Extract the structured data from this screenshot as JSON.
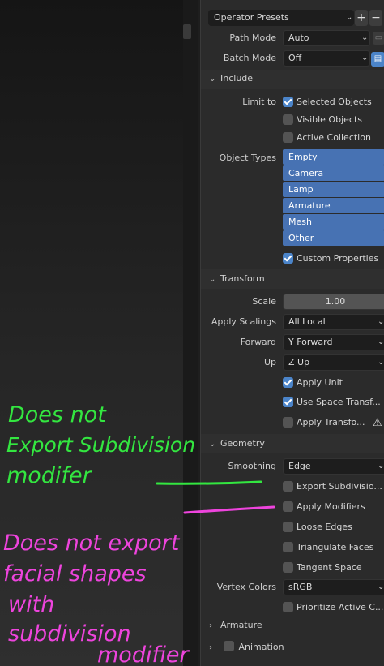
{
  "colors": {
    "accent": "#4772b3",
    "annotation_green": "#33e640",
    "annotation_pink": "#ee44dd"
  },
  "header": {
    "presets_label": "Operator Presets",
    "add_icon": "+",
    "remove_icon": "−"
  },
  "fields": {
    "path_mode": {
      "label": "Path Mode",
      "value": "Auto"
    },
    "batch_mode": {
      "label": "Batch Mode",
      "value": "Off"
    }
  },
  "include": {
    "title": "Include",
    "limit_to_label": "Limit to",
    "selected_objects": "Selected Objects",
    "visible_objects": "Visible Objects",
    "active_collection": "Active Collection",
    "object_types_label": "Object Types",
    "object_types": [
      "Empty",
      "Camera",
      "Lamp",
      "Armature",
      "Mesh",
      "Other"
    ],
    "custom_properties": "Custom Properties"
  },
  "transform": {
    "title": "Transform",
    "scale_label": "Scale",
    "scale_value": "1.00",
    "apply_scalings_label": "Apply Scalings",
    "apply_scalings_value": "All Local",
    "forward_label": "Forward",
    "forward_value": "Y Forward",
    "up_label": "Up",
    "up_value": "Z Up",
    "apply_unit": "Apply Unit",
    "use_space_transform": "Use Space Transf...",
    "apply_transform": "Apply Transfo..."
  },
  "geometry": {
    "title": "Geometry",
    "smoothing_label": "Smoothing",
    "smoothing_value": "Edge",
    "export_subdivision": "Export Subdivisio...",
    "apply_modifiers": "Apply Modifiers",
    "loose_edges": "Loose Edges",
    "triangulate_faces": "Triangulate Faces",
    "tangent_space": "Tangent Space",
    "vertex_colors_label": "Vertex Colors",
    "vertex_colors_value": "sRGB",
    "prioritize_active": "Prioritize Active C..."
  },
  "footer": {
    "armature": "Armature",
    "animation": "Animation"
  },
  "annotations": {
    "green": [
      "Does not",
      "Export Subdivision",
      "modifer"
    ],
    "pink": [
      "Does not export",
      "facial shapes",
      "with",
      "subdivision",
      "modifier"
    ]
  }
}
